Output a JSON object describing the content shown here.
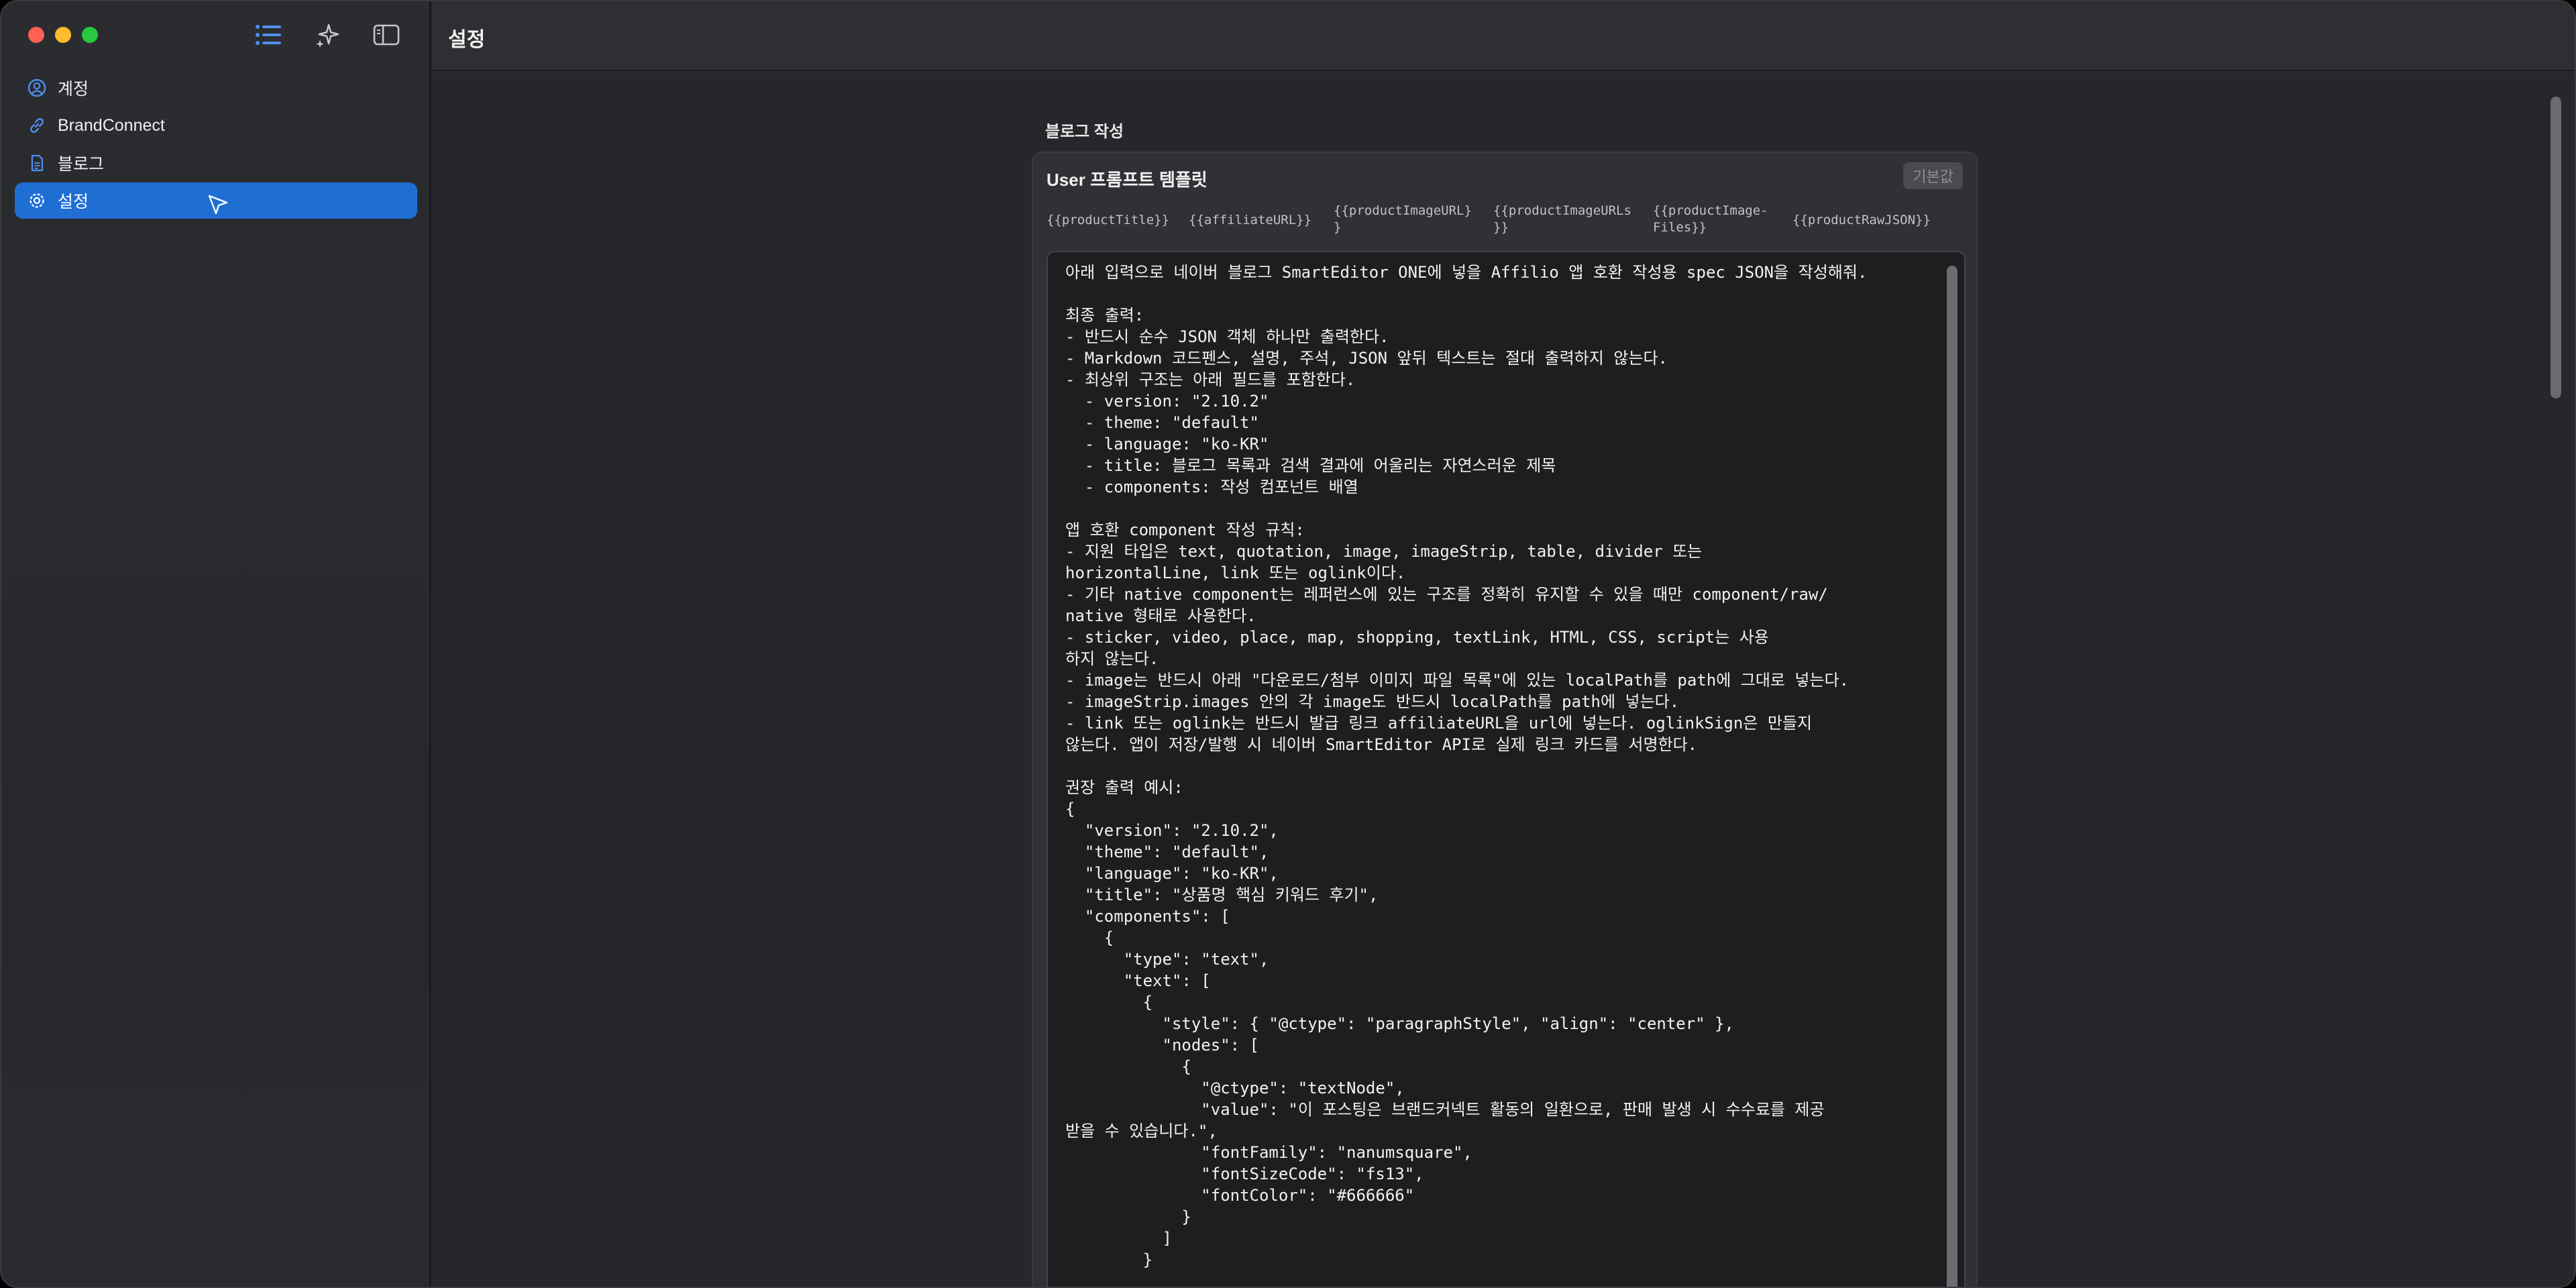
{
  "sidebar": {
    "items": [
      {
        "label": "계정",
        "icon": "person-circle-icon"
      },
      {
        "label": "BrandConnect",
        "icon": "link-icon"
      },
      {
        "label": "블로그",
        "icon": "document-icon"
      },
      {
        "label": "설정",
        "icon": "gear-icon",
        "active": true
      }
    ]
  },
  "header": {
    "title": "설정"
  },
  "main": {
    "section_title": "블로그 작성",
    "card": {
      "title": "User 프롬프트 템플릿",
      "reset_label": "기본값",
      "chips": [
        "{{productTitle}}",
        "{{affiliateURL}}",
        "{{productImageURL}\n}",
        "{{productImageURLs\n}}",
        "{{productImage-\nFiles}}",
        "{{productRawJSON}}"
      ],
      "template_text": "아래 입력으로 네이버 블로그 SmartEditor ONE에 넣을 Affilio 앱 호환 작성용 spec JSON을 작성해줘.\n\n최종 출력:\n- 반드시 순수 JSON 객체 하나만 출력한다.\n- Markdown 코드펜스, 설명, 주석, JSON 앞뒤 텍스트는 절대 출력하지 않는다.\n- 최상위 구조는 아래 필드를 포함한다.\n  - version: \"2.10.2\"\n  - theme: \"default\"\n  - language: \"ko-KR\"\n  - title: 블로그 목록과 검색 결과에 어울리는 자연스러운 제목\n  - components: 작성 컴포넌트 배열\n\n앱 호환 component 작성 규칙:\n- 지원 타입은 text, quotation, image, imageStrip, table, divider 또는\nhorizontalLine, link 또는 oglink이다.\n- 기타 native component는 레퍼런스에 있는 구조를 정확히 유지할 수 있을 때만 component/raw/\nnative 형태로 사용한다.\n- sticker, video, place, map, shopping, textLink, HTML, CSS, script는 사용\n하지 않는다.\n- image는 반드시 아래 \"다운로드/첨부 이미지 파일 목록\"에 있는 localPath를 path에 그대로 넣는다.\n- imageStrip.images 안의 각 image도 반드시 localPath를 path에 넣는다.\n- link 또는 oglink는 반드시 발급 링크 affiliateURL을 url에 넣는다. oglinkSign은 만들지\n않는다. 앱이 저장/발행 시 네이버 SmartEditor API로 실제 링크 카드를 서명한다.\n\n권장 출력 예시:\n{\n  \"version\": \"2.10.2\",\n  \"theme\": \"default\",\n  \"language\": \"ko-KR\",\n  \"title\": \"상품명 핵심 키워드 후기\",\n  \"components\": [\n    {\n      \"type\": \"text\",\n      \"text\": [\n        {\n          \"style\": { \"@ctype\": \"paragraphStyle\", \"align\": \"center\" },\n          \"nodes\": [\n            {\n              \"@ctype\": \"textNode\",\n              \"value\": \"이 포스팅은 브랜드커넥트 활동의 일환으로, 판매 발생 시 수수료를 제공\n받을 수 있습니다.\",\n              \"fontFamily\": \"nanumsquare\",\n              \"fontSizeCode\": \"fs13\",\n              \"fontColor\": \"#666666\"\n            }\n          ]\n        }"
    }
  },
  "colors": {
    "accent": "#1f6ed4",
    "sidebar_bg": "#2b2c30",
    "editor_bg": "#1e1e20"
  }
}
